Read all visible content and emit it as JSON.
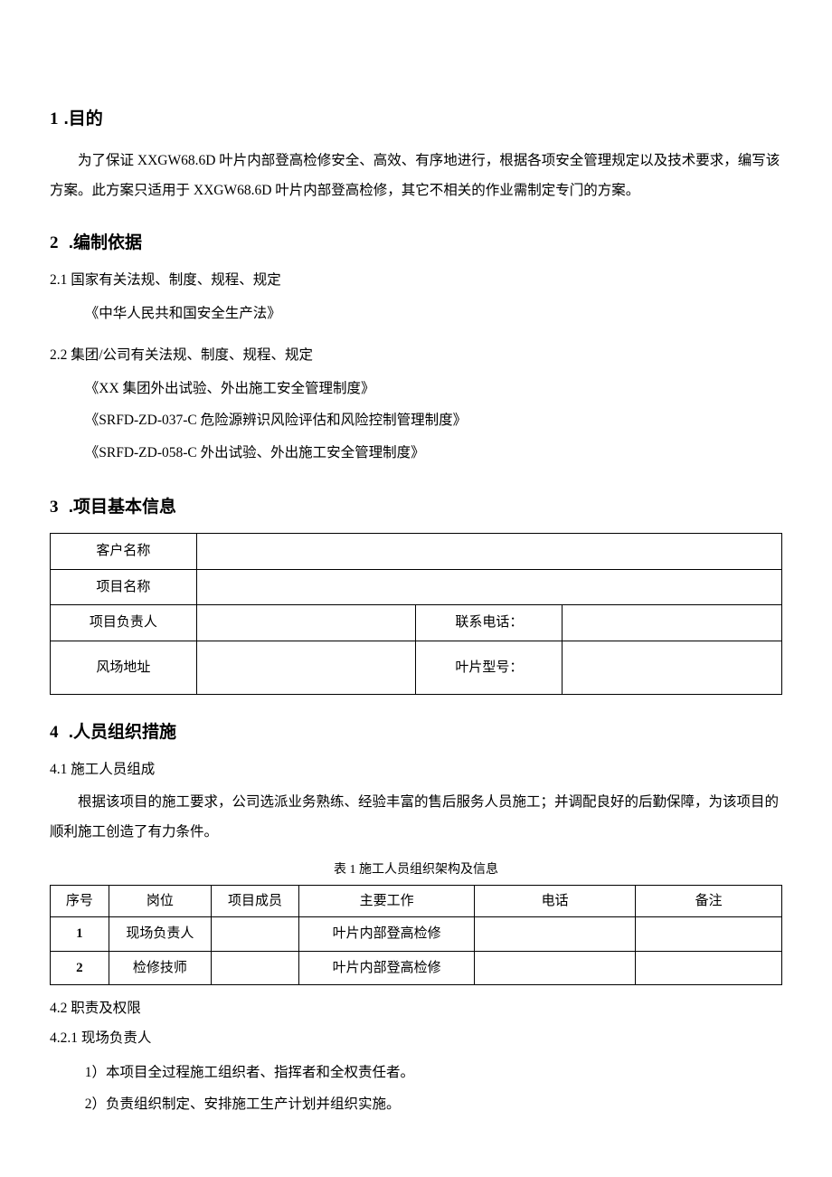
{
  "s1": {
    "num": "1",
    "title": ".目的",
    "p1": "为了保证 XXGW68.6D 叶片内部登高检修安全、高效、有序地进行，根据各项安全管理规定以及技术要求，编写该方案。此方案只适用于 XXGW68.6D 叶片内部登高检修，其它不相关的作业需制定专门的方案。"
  },
  "s2": {
    "num": "2",
    "title": " .编制依据",
    "i21": "2.1  国家有关法规、制度、规程、规定",
    "i21a": "《中华人民共和国安全生产法》",
    "i22": "2.2  集团/公司有关法规、制度、规程、规定",
    "i22a": "《XX 集团外出试验、外出施工安全管理制度》",
    "i22b": "《SRFD-ZD-037-C 危险源辨识风险评估和风险控制管理制度》",
    "i22c": "《SRFD-ZD-058-C 外出试验、外出施工安全管理制度》"
  },
  "s3": {
    "num": "3",
    "title": " .项目基本信息",
    "labels": {
      "customer": "客户名称",
      "project": "项目名称",
      "leader": "项目负责人",
      "phone": "联系电话：",
      "addr": "风场地址",
      "model": "叶片型号："
    },
    "values": {
      "customer": "",
      "project": "",
      "leader": "",
      "phone": "",
      "addr": "",
      "model": ""
    }
  },
  "s4": {
    "num": "4",
    "title": " .人员组织措施",
    "i41": "4.1  施工人员组成",
    "p41": "根据该项目的施工要求，公司选派业务熟练、经验丰富的售后服务人员施工；并调配良好的后勤保障，为该项目的顺利施工创造了有力条件。",
    "caption": "表 1 施工人员组织架构及信息",
    "headers": {
      "seq": "序号",
      "post": "岗位",
      "member": "项目成员",
      "work": "主要工作",
      "phone": "电话",
      "note": "备注"
    },
    "rows": [
      {
        "seq": "1",
        "post": "现场负责人",
        "member": "",
        "work": "叶片内部登高检修",
        "phone": "",
        "note": ""
      },
      {
        "seq": "2",
        "post": "检修技师",
        "member": "",
        "work": "叶片内部登高检修",
        "phone": "",
        "note": ""
      }
    ],
    "i42": "4.2  职责及权限",
    "i421": "4.2.1 现场负责人",
    "d1": "1）本项目全过程施工组织者、指挥者和全权责任者。",
    "d2": "2）负责组织制定、安排施工生产计划并组织实施。"
  }
}
